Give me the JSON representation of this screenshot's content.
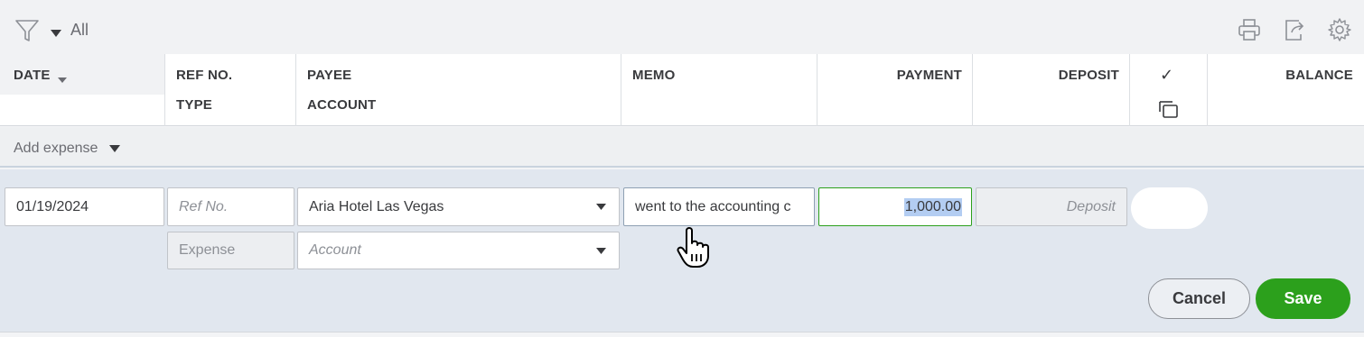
{
  "filter": {
    "label": "All",
    "icon": "filter-icon"
  },
  "toolbar": {
    "icons": [
      "print-icon",
      "export-icon",
      "settings-icon"
    ]
  },
  "columns": {
    "date": "DATE",
    "ref_no": "REF NO.",
    "type": "TYPE",
    "payee": "PAYEE",
    "account": "ACCOUNT",
    "memo": "MEMO",
    "payment": "PAYMENT",
    "deposit": "DEPOSIT",
    "check": "✓",
    "balance": "BALANCE"
  },
  "add_expense": {
    "label": "Add expense"
  },
  "edit_row": {
    "date": "01/19/2024",
    "ref_no_placeholder": "Ref No.",
    "payee": "Aria Hotel Las Vegas",
    "type": "Expense",
    "account_placeholder": "Account",
    "memo": "went to the accounting c",
    "payment": "1,000.00",
    "deposit_placeholder": "Deposit"
  },
  "buttons": {
    "cancel": "Cancel",
    "save": "Save"
  },
  "colors": {
    "save_green": "#2ca01c",
    "edit_bg": "#e1e7ef",
    "selection": "#b3cdf2"
  }
}
